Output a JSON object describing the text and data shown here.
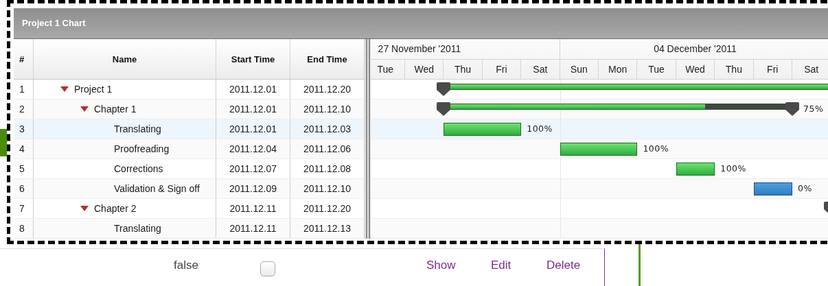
{
  "panel": {
    "title": "Project 1 Chart"
  },
  "grid": {
    "columns": [
      "#",
      "Name",
      "Start Time",
      "End Time"
    ],
    "rows": [
      {
        "number": "1",
        "name": "Project 1",
        "start": "2011.12.01",
        "end": "2011.12.20",
        "kind": "summary",
        "expanded": true,
        "selected": false,
        "children": [
          {
            "number": "2",
            "name": "Chapter 1",
            "start": "2011.12.01",
            "end": "2011.12.10",
            "kind": "summary",
            "expanded": true,
            "selected": false,
            "level": 0.75,
            "progress": "75%",
            "children": [
              {
                "number": "3",
                "name": "Translating",
                "start": "2011.12.01",
                "end": "2011.12.03",
                "kind": "task",
                "selected": true,
                "level": 1,
                "progress": "100%"
              },
              {
                "number": "4",
                "name": "Proofreading",
                "start": "2011.12.04",
                "end": "2011.12.06",
                "kind": "task",
                "selected": false,
                "level": 1,
                "progress": "100%"
              },
              {
                "number": "5",
                "name": "Corrections",
                "start": "2011.12.07",
                "end": "2011.12.08",
                "kind": "task",
                "selected": false,
                "level": 1,
                "progress": "100%"
              },
              {
                "number": "6",
                "name": "Validation & Sign off",
                "start": "2011.12.09",
                "end": "2011.12.10",
                "kind": "task",
                "selected": false,
                "level": 0,
                "progress": "0%"
              }
            ]
          },
          {
            "number": "7",
            "name": "Chapter 2",
            "start": "2011.12.11",
            "end": "2011.12.20",
            "kind": "summary",
            "expanded": true,
            "selected": false,
            "children": [
              {
                "number": "8",
                "name": "Translating",
                "start": "2011.12.11",
                "end": "2011.12.13",
                "kind": "task",
                "selected": false
              }
            ]
          }
        ]
      }
    ]
  },
  "timeline": {
    "weeks": [
      {
        "label": "27 November '2011",
        "days": [
          "Tue",
          "Wed",
          "Thu",
          "Fri",
          "Sat"
        ]
      },
      {
        "label": "04 December '2011",
        "days": [
          "Sun",
          "Mon",
          "Tue",
          "Wed",
          "Thu",
          "Fri",
          "Sat"
        ]
      }
    ]
  },
  "record_row": {
    "value": "false",
    "checked": false,
    "links": [
      "Show",
      "Edit",
      "Delete"
    ]
  }
}
